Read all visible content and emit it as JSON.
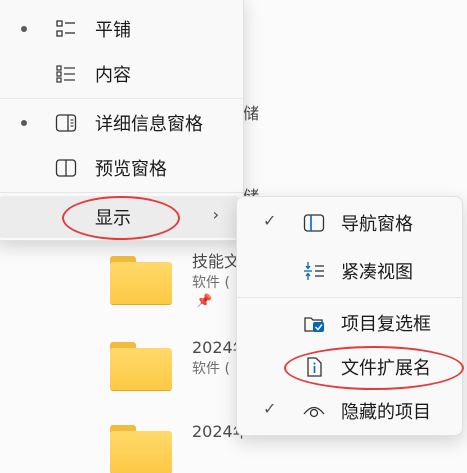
{
  "background": {
    "partial_text": [
      "储",
      "储",
      "技能文",
      "2024年",
      "2024年"
    ],
    "items": [
      {
        "title": "技能文",
        "sub": "软件 ("
      },
      {
        "title": "2024年",
        "sub": "软件 ("
      },
      {
        "title": "2024年",
        "sub": ""
      }
    ]
  },
  "view_menu": {
    "items": [
      {
        "label": "平铺",
        "selected": true,
        "icon": "tiles-icon"
      },
      {
        "label": "内容",
        "selected": false,
        "icon": "content-icon"
      },
      {
        "label": "详细信息窗格",
        "selected": true,
        "icon": "details-pane-icon"
      },
      {
        "label": "预览窗格",
        "selected": false,
        "icon": "preview-pane-icon"
      },
      {
        "label": "显示",
        "has_submenu": true,
        "hovered": true
      }
    ]
  },
  "show_submenu": {
    "items": [
      {
        "label": "导航窗格",
        "checked": true,
        "icon": "navigation-pane-icon"
      },
      {
        "label": "紧凑视图",
        "checked": false,
        "icon": "compact-view-icon"
      },
      {
        "label": "项目复选框",
        "checked": false,
        "icon": "item-checkbox-icon"
      },
      {
        "label": "文件扩展名",
        "checked": false,
        "icon": "file-extension-icon"
      },
      {
        "label": "隐藏的项目",
        "checked": true,
        "icon": "hidden-items-icon"
      }
    ]
  },
  "colors": {
    "annotation": "#e23c3c",
    "accent": "#0067c0",
    "folder": "#fcc945"
  }
}
